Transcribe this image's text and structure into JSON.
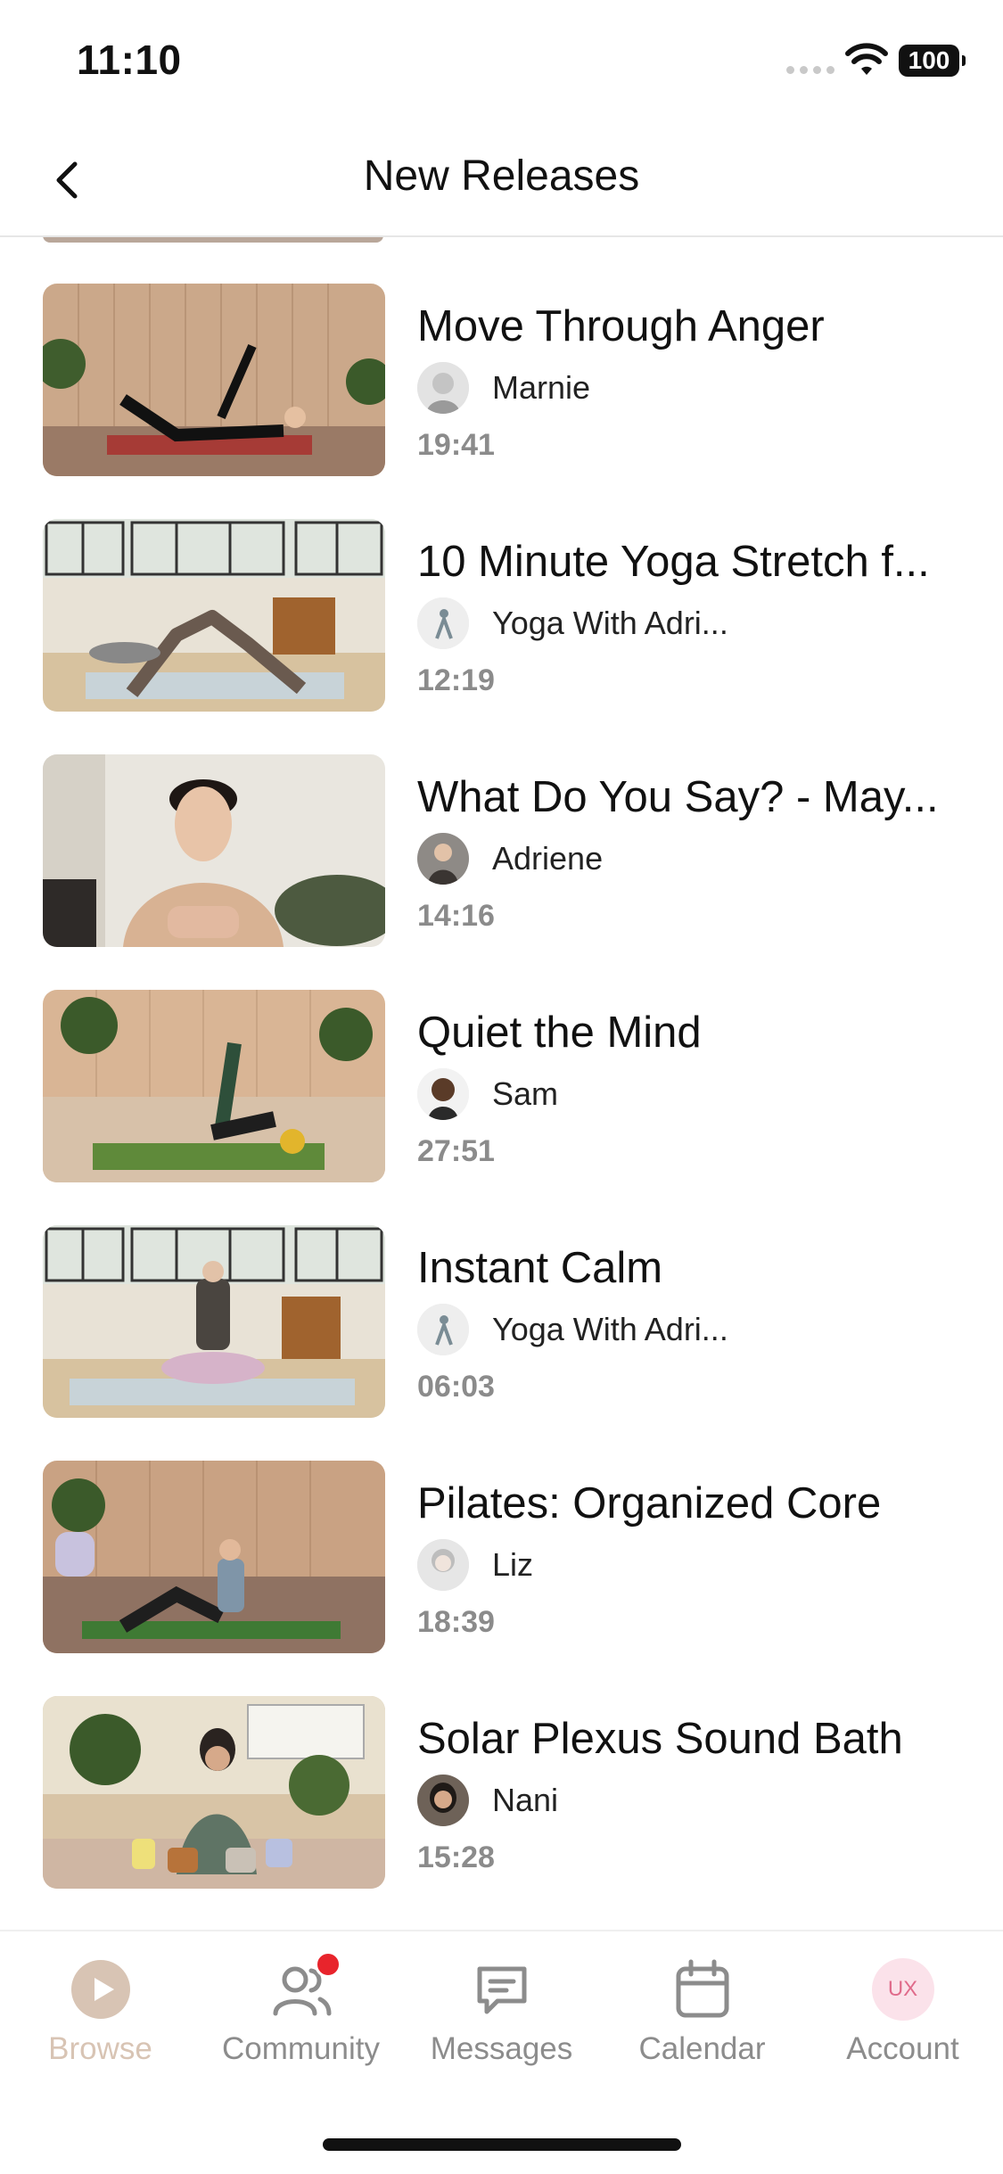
{
  "status_bar": {
    "time": "11:10",
    "battery": "100"
  },
  "nav": {
    "title": "New Releases"
  },
  "videos": [
    {
      "title": "Move Through Anger",
      "instructor": "Marnie",
      "duration": "19:41"
    },
    {
      "title": "10 Minute Yoga Stretch f...",
      "instructor": "Yoga With Adri...",
      "duration": "12:19"
    },
    {
      "title": "What Do You Say? - May...",
      "instructor": "Adriene",
      "duration": "14:16"
    },
    {
      "title": "Quiet the Mind",
      "instructor": "Sam",
      "duration": "27:51"
    },
    {
      "title": "Instant Calm",
      "instructor": "Yoga With Adri...",
      "duration": "06:03"
    },
    {
      "title": "Pilates: Organized Core",
      "instructor": "Liz",
      "duration": "18:39"
    },
    {
      "title": "Solar Plexus Sound Bath",
      "instructor": "Nani",
      "duration": "15:28"
    }
  ],
  "tabs": [
    {
      "label": "Browse",
      "icon": "play-icon",
      "active": true
    },
    {
      "label": "Community",
      "icon": "people-icon",
      "badge": true
    },
    {
      "label": "Messages",
      "icon": "message-icon"
    },
    {
      "label": "Calendar",
      "icon": "calendar-icon"
    },
    {
      "label": "Account",
      "icon": "avatar",
      "avatar_text": "UX"
    }
  ],
  "colors": {
    "active_tab": "#d8c4b4",
    "inactive_tab": "#8c8c8c",
    "badge": "#e8242c",
    "duration_text": "#8b8b8b"
  }
}
